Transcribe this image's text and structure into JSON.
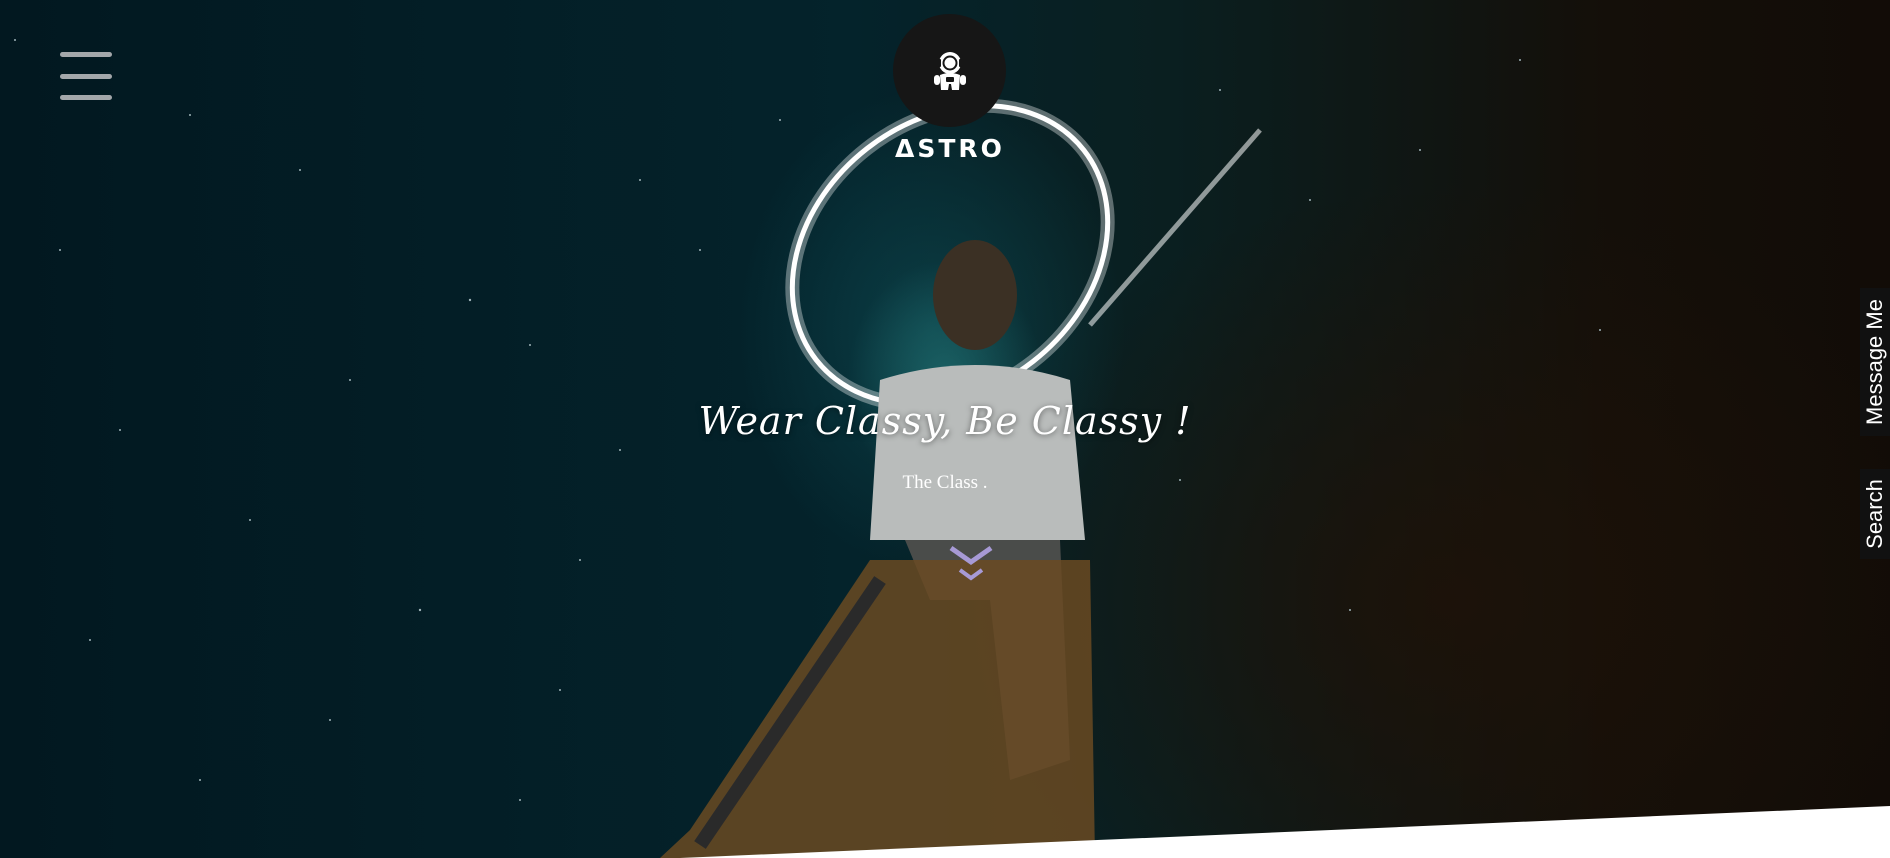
{
  "nav": {
    "menu_icon": "hamburger-menu-icon"
  },
  "logo": {
    "icon": "astronaut-icon",
    "brand_text": "ΔSTRO"
  },
  "hero": {
    "headline": "Wear Classy, Be Classy !",
    "subline": "The Class .",
    "scroll_icon": "double-chevron-down-icon"
  },
  "side_tabs": {
    "message": "Message Me",
    "search": "Search"
  },
  "colors": {
    "background": "#02151c",
    "logo_circle": "#161616",
    "menu_bars": "#a3a7aa",
    "chevron": "#a79ad6",
    "side_tab": "#111111"
  }
}
